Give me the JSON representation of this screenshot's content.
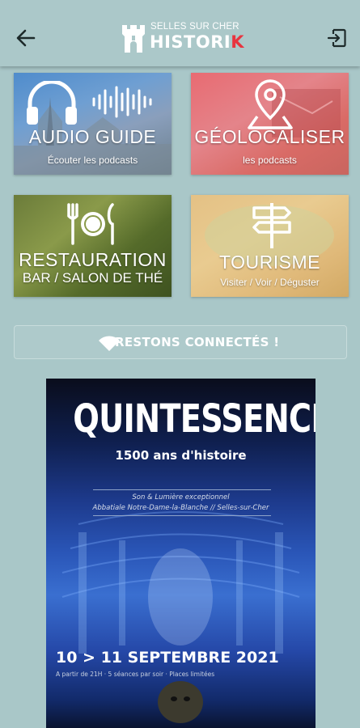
{
  "header": {
    "logo_top": "SELLES SUR CHER",
    "logo_main": "HISTORI",
    "logo_accent": "K",
    "back_icon": "arrow-left-icon",
    "exit_icon": "exit-icon"
  },
  "tiles": [
    {
      "title": "AUDIO GUIDE",
      "subtitle": "Écouter les podcasts",
      "icon": "headphones-icon"
    },
    {
      "title": "GÉOLOCALISER",
      "subtitle": "les podcasts",
      "icon": "map-pin-icon"
    },
    {
      "title": "RESTAURATION",
      "subtitle": "BAR / SALON DE THÉ",
      "icon": "plate-cutlery-icon"
    },
    {
      "title": "TOURISME",
      "subtitle": "Visiter / Voir / Déguster",
      "icon": "signpost-icon"
    }
  ],
  "connect": {
    "label": "RESTONS CONNECTÉS !",
    "icon": "wifi-icon"
  },
  "poster": {
    "title": "QUINTESSENCE",
    "subtitle": "1500 ans d'histoire",
    "line1": "Son & Lumière exceptionnel",
    "line2": "Abbatiale Notre-Dame-la-Blanche  //  Selles-sur-Cher",
    "date": "10 > 11 SEPTEMBRE 2021",
    "info": "A partir de 21H  ·  5 séances par soir  ·  Places limitées"
  },
  "colors": {
    "background": "#a9c7c8",
    "accent": "#e8343f"
  }
}
